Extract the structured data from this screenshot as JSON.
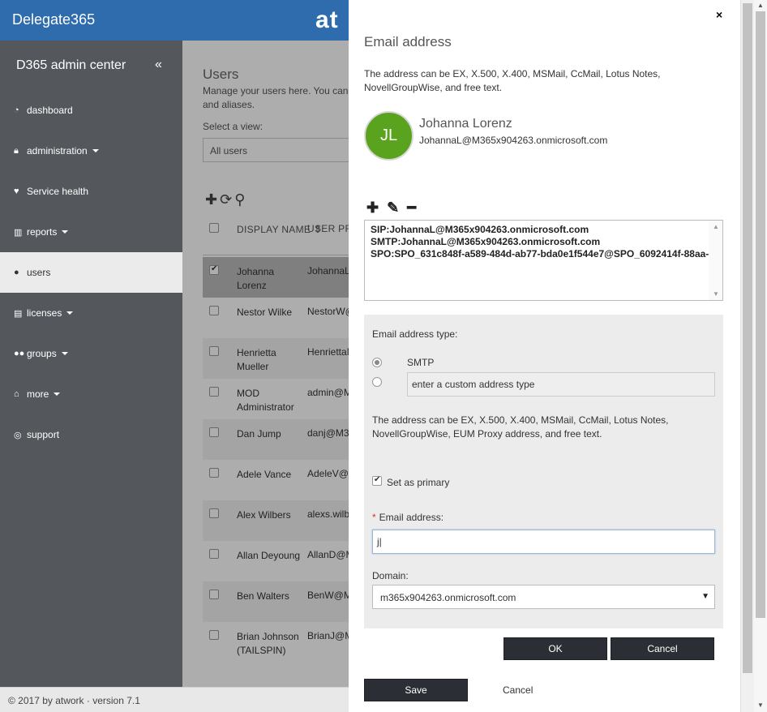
{
  "header": {
    "brand": "Delegate365",
    "logo_partial": "at"
  },
  "sidebar": {
    "title": "D365 admin center",
    "collapse": "«",
    "items": [
      {
        "label": "dashboard",
        "icon": "dashboard-icon"
      },
      {
        "label": "administration",
        "icon": "lock-icon"
      },
      {
        "label": "Service health",
        "icon": "heartbeat-icon"
      },
      {
        "label": "reports",
        "icon": "bar-chart-icon"
      },
      {
        "label": "users",
        "icon": "user-icon"
      },
      {
        "label": "licenses",
        "icon": "file-icon"
      },
      {
        "label": "groups",
        "icon": "users-icon"
      },
      {
        "label": "more",
        "icon": "home-icon"
      },
      {
        "label": "support",
        "icon": "lifebuoy-icon"
      }
    ]
  },
  "footer": {
    "text": "© 2017 by atwork · version 7.1"
  },
  "users": {
    "title": "Users",
    "desc_line1": "Manage your users here. You can",
    "desc_line2": "and aliases.",
    "view_label": "Select a view:",
    "view_value": "All users",
    "col_name": "DISPLAY NAME",
    "col_upn": "USER PR",
    "rows": [
      {
        "name": "Johanna Lorenz",
        "upn": "JohannaL"
      },
      {
        "name": "Nestor Wilke",
        "upn": "NestorW@"
      },
      {
        "name": "Henrietta Mueller",
        "upn": "HenriettaM"
      },
      {
        "name": "MOD Administrator",
        "upn": "admin@M"
      },
      {
        "name": "Dan Jump",
        "upn": "danj@M3"
      },
      {
        "name": "Adele Vance",
        "upn": "AdeleV@"
      },
      {
        "name": "Alex Wilbers",
        "upn": "alexs.wilb"
      },
      {
        "name": "Allan Deyoung",
        "upn": "AllanD@M"
      },
      {
        "name": "Ben Walters",
        "upn": "BenW@M"
      },
      {
        "name": "Brian Johnson (TAILSPIN)",
        "upn": "BrianJ@M"
      }
    ]
  },
  "panel": {
    "close": "×",
    "title": "Email address",
    "desc": "The address can be EX, X.500, X.400, MSMail, CcMail, Lotus Notes, NovellGroupWise, and free text.",
    "initials": "JL",
    "name": "Johanna Lorenz",
    "upn": "JohannaL@M365x904263.onmicrosoft.com",
    "addresses": [
      "SIP:JohannaL@M365x904263.onmicrosoft.com",
      "SMTP:JohannaL@M365x904263.onmicrosoft.com",
      "SPO:SPO_631c848f-a589-484d-ab77-bda0e1f544e7@SPO_6092414f-88aa-"
    ],
    "editor": {
      "type_label": "Email address type:",
      "smtp_label": "SMTP",
      "custom_placeholder": "enter a custom address type",
      "desc": "The address can be EX, X.500, X.400, MSMail, CcMail, Lotus Notes, NovellGroupWise, EUM Proxy address, and free text.",
      "primary_label": "Set as primary",
      "email_label": "Email address:",
      "email_value": "j|",
      "domain_label": "Domain:",
      "domain_value": "m365x904263.onmicrosoft.com"
    },
    "ok": "OK",
    "cancel": "Cancel",
    "save": "Save",
    "cancel2": "Cancel"
  }
}
